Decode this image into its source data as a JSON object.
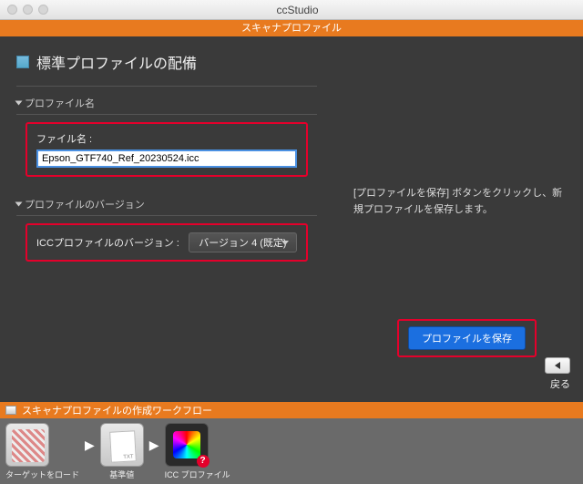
{
  "window": {
    "title": "ccStudio"
  },
  "subheader": "スキャナプロファイル",
  "page": {
    "title": "標準プロファイルの配備"
  },
  "sections": {
    "profileName": {
      "header": "プロファイル名",
      "label": "ファイル名 :",
      "value": "Epson_GTF740_Ref_20230524.icc"
    },
    "profileVersion": {
      "header": "プロファイルのバージョン",
      "label": "ICCプロファイルのバージョン :",
      "selected": "バージョン 4 (既定)"
    }
  },
  "info": "[プロファイルを保存] ボタンをクリックし、新規プロファイルを保存します。",
  "buttons": {
    "save": "プロファイルを保存",
    "backLabel": "戻る"
  },
  "workflow": {
    "title": "スキャナプロファイルの作成ワークフロー",
    "steps": [
      {
        "label": "ターゲットをロード"
      },
      {
        "label": "基準値"
      },
      {
        "label": "ICC プロファイル"
      }
    ]
  }
}
